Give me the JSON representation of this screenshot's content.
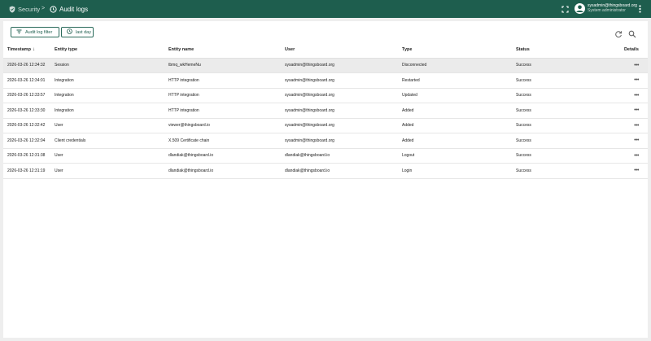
{
  "breadcrumb": {
    "parent": "Security",
    "separator": ">",
    "current": "Audit logs"
  },
  "user": {
    "email": "sysadmin@thingsboard.org",
    "role": "System administrator"
  },
  "toolbar": {
    "filter_label": "Audit log filter",
    "time_label": "last day"
  },
  "table": {
    "headers": {
      "timestamp": "Timestamp",
      "entity_type": "Entity type",
      "entity_name": "Entity name",
      "user": "User",
      "type": "Type",
      "status": "Status",
      "details": "Details"
    },
    "rows": [
      {
        "timestamp": "2026-03-26 12:34:32",
        "entity_type": "Session",
        "entity_name": "tbmq_wkHemeNu",
        "user": "sysadmin@thingsboard.org",
        "type": "Disconnected",
        "status": "Success",
        "details": "..."
      },
      {
        "timestamp": "2026-03-26 12:34:01",
        "entity_type": "Integration",
        "entity_name": "HTTP integration",
        "user": "sysadmin@thingsboard.org",
        "type": "Restarted",
        "status": "Success",
        "details": "..."
      },
      {
        "timestamp": "2026-03-26 12:33:57",
        "entity_type": "Integration",
        "entity_name": "HTTP integration",
        "user": "sysadmin@thingsboard.org",
        "type": "Updated",
        "status": "Success",
        "details": "..."
      },
      {
        "timestamp": "2026-03-26 12:33:30",
        "entity_type": "Integration",
        "entity_name": "HTTP integration",
        "user": "sysadmin@thingsboard.org",
        "type": "Added",
        "status": "Success",
        "details": "..."
      },
      {
        "timestamp": "2026-03-26 12:32:42",
        "entity_type": "User",
        "entity_name": "viewer@thingsboard.io",
        "user": "sysadmin@thingsboard.org",
        "type": "Added",
        "status": "Success",
        "details": "..."
      },
      {
        "timestamp": "2026-03-26 12:32:04",
        "entity_type": "Client credentials",
        "entity_name": "X.509 Certificate chain",
        "user": "sysadmin@thingsboard.org",
        "type": "Added",
        "status": "Success",
        "details": "..."
      },
      {
        "timestamp": "2026-03-26 12:31:38",
        "entity_type": "User",
        "entity_name": "dlandiak@thingsboard.io",
        "user": "dlandiak@thingsboard.io",
        "type": "Logout",
        "status": "Success",
        "details": "..."
      },
      {
        "timestamp": "2026-03-26 12:31:19",
        "entity_type": "User",
        "entity_name": "dlandiak@thingsboard.io",
        "user": "dlandiak@thingsboard.io",
        "type": "Login",
        "status": "Success",
        "details": "..."
      }
    ]
  },
  "colors": {
    "topbar": "#1e5e4e",
    "accent": "#2b6b5b",
    "background": "#eeeeee"
  },
  "icons": [
    "shield-icon",
    "audit-log-icon",
    "fullscreen-icon",
    "account-circle-icon",
    "more-vert-icon",
    "filter-icon",
    "clock-icon",
    "refresh-icon",
    "search-icon",
    "more-horiz-icon",
    "arrow-down-icon"
  ]
}
